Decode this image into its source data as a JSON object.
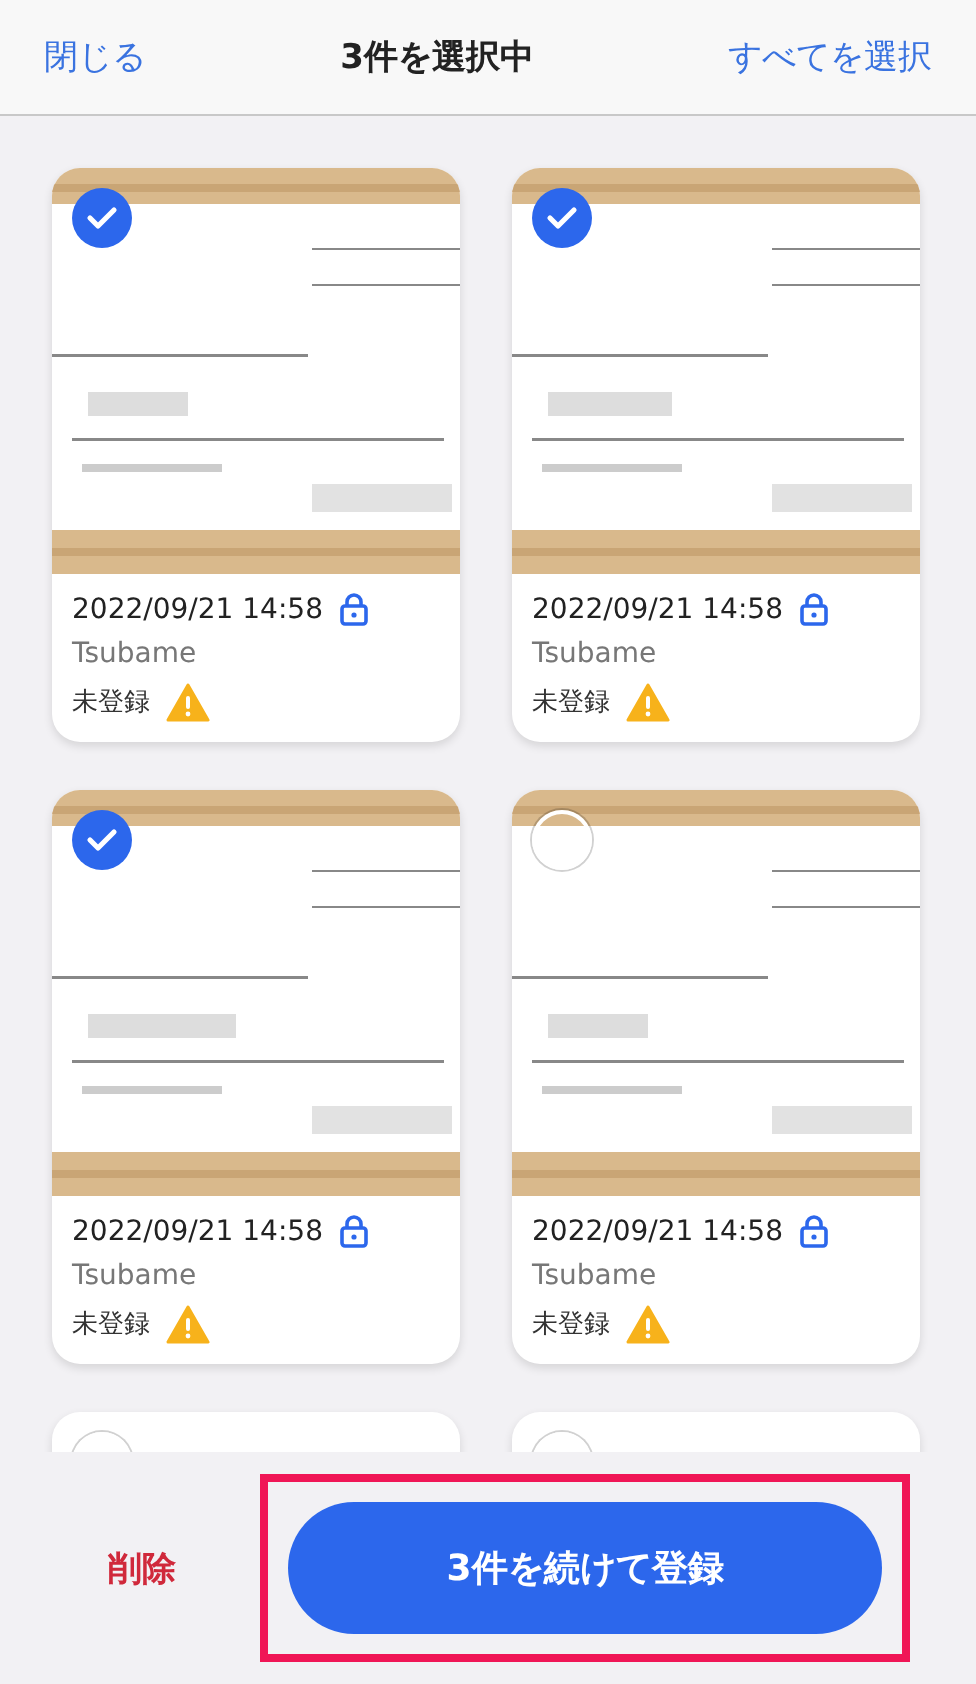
{
  "header": {
    "close": "閉じる",
    "title": "3件を選択中",
    "select_all": "すべてを選択"
  },
  "cards": [
    {
      "selected": true,
      "datetime": "2022/09/21 14:58",
      "locked": true,
      "owner": "Tsubame",
      "status": "未登録",
      "warning": true
    },
    {
      "selected": true,
      "datetime": "2022/09/21 14:58",
      "locked": true,
      "owner": "Tsubame",
      "status": "未登録",
      "warning": true
    },
    {
      "selected": true,
      "datetime": "2022/09/21 14:58",
      "locked": true,
      "owner": "Tsubame",
      "status": "未登録",
      "warning": true
    },
    {
      "selected": false,
      "datetime": "2022/09/21 14:58",
      "locked": true,
      "owner": "Tsubame",
      "status": "未登録",
      "warning": true
    },
    {
      "selected": false
    },
    {
      "selected": false
    }
  ],
  "footer": {
    "delete": "削除",
    "register": "3件を続けて登録",
    "highlighted": true
  }
}
